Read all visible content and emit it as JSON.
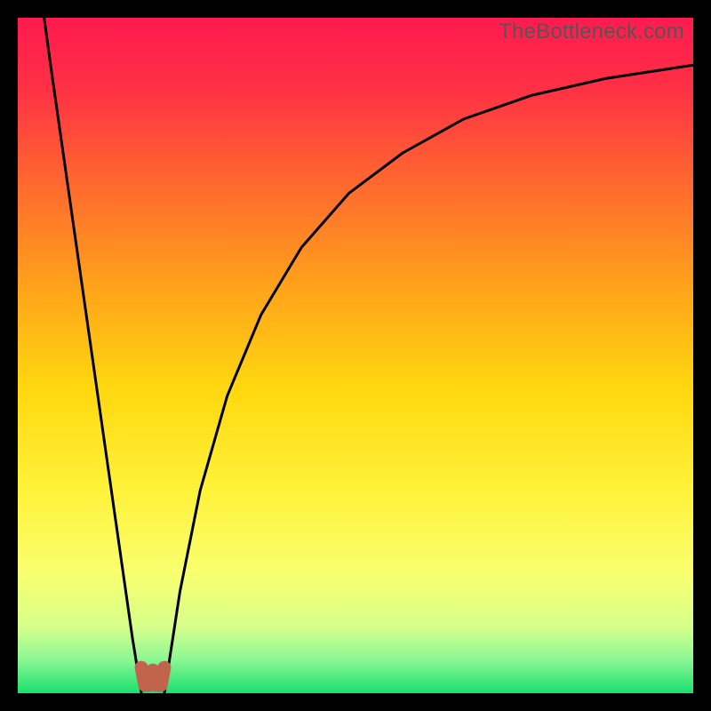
{
  "watermark": "TheBottleneck.com",
  "chart_data": {
    "type": "line",
    "title": "",
    "xlabel": "",
    "ylabel": "",
    "xlim": [
      0,
      100
    ],
    "ylim": [
      0,
      100
    ],
    "grid": false,
    "background_gradient": {
      "stops": [
        {
          "offset": 0.0,
          "color": "#ff1a4f"
        },
        {
          "offset": 0.1,
          "color": "#ff2f45"
        },
        {
          "offset": 0.25,
          "color": "#ff6a2e"
        },
        {
          "offset": 0.4,
          "color": "#ffa31a"
        },
        {
          "offset": 0.55,
          "color": "#ffd80f"
        },
        {
          "offset": 0.7,
          "color": "#fff23a"
        },
        {
          "offset": 0.82,
          "color": "#f9ff6e"
        },
        {
          "offset": 0.9,
          "color": "#d8ff8a"
        },
        {
          "offset": 0.95,
          "color": "#8cf795"
        },
        {
          "offset": 1.0,
          "color": "#19e06f"
        }
      ]
    },
    "series": [
      {
        "name": "left-branch",
        "stroke": "#000000",
        "stroke_width": 3,
        "x": [
          3.9,
          5,
          7,
          9,
          11,
          13,
          15,
          17,
          18.3
        ],
        "y": [
          100,
          92,
          78,
          64,
          50,
          36,
          22,
          8,
          0
        ]
      },
      {
        "name": "right-branch",
        "stroke": "#000000",
        "stroke_width": 3,
        "x": [
          21.7,
          24,
          27,
          31,
          36,
          42,
          49,
          57,
          66,
          76,
          87,
          100
        ],
        "y": [
          0,
          15,
          30,
          44,
          56,
          66,
          74,
          80,
          85,
          88.5,
          91,
          93
        ]
      },
      {
        "name": "bottom-lobe",
        "stroke": "#c1644e",
        "stroke_width": 15,
        "x": [
          18.3,
          18.8,
          19.5,
          20,
          20.5,
          21.2,
          21.7
        ],
        "y": [
          3.8,
          1.2,
          1.2,
          3.4,
          1.2,
          1.2,
          3.8
        ]
      }
    ]
  }
}
